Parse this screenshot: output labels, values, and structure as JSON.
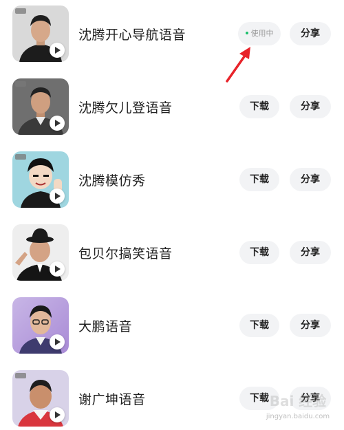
{
  "items": [
    {
      "title": "沈腾开心导航语音",
      "status": "使用中",
      "share": "分享"
    },
    {
      "title": "沈腾欠儿登语音",
      "download": "下载",
      "share": "分享"
    },
    {
      "title": "沈腾模仿秀",
      "download": "下载",
      "share": "分享"
    },
    {
      "title": "包贝尔搞笑语音",
      "download": "下载",
      "share": "分享"
    },
    {
      "title": "大鹏语音",
      "download": "下载",
      "share": "分享"
    },
    {
      "title": "谢广坤语音",
      "download": "下载",
      "share": "分享"
    }
  ],
  "watermark": {
    "text": "jingyan.baidu.com"
  },
  "colors": {
    "status_dot": "#1bbf6b",
    "arrow": "#e8232a",
    "button_bg": "#f2f3f5"
  }
}
